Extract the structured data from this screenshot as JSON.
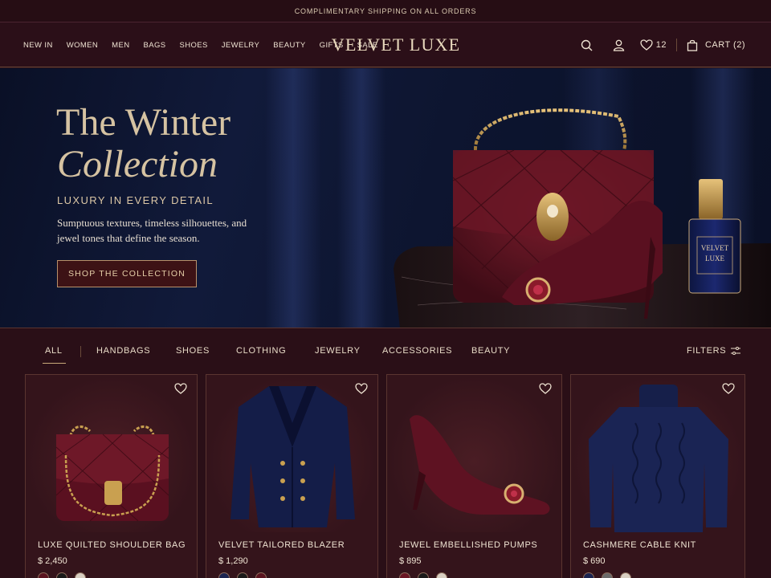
{
  "announcement": "COMPLIMENTARY SHIPPING ON ALL ORDERS",
  "header": {
    "brand": "VELVET LUXE",
    "nav": [
      "NEW IN",
      "WOMEN",
      "MEN",
      "BAGS",
      "SHOES",
      "JEWELRY",
      "BEAUTY",
      "GIFTS",
      "SALE"
    ],
    "wishlist_count": "12",
    "cart_label": "CART (2)"
  },
  "hero": {
    "title_line1": "The Winter",
    "title_line2": "Collection",
    "tagline": "LUXURY IN EVERY DETAIL",
    "description": "Sumptuous textures, timeless silhouettes, and jewel tones that define the season.",
    "cta": "SHOP THE COLLECTION",
    "perfume_label_line1": "VELVET",
    "perfume_label_line2": "LUXE"
  },
  "filters": {
    "tabs": [
      "ALL",
      "HANDBAGS",
      "SHOES",
      "CLOTHING",
      "JEWELRY",
      "ACCESSORIES",
      "BEAUTY"
    ],
    "active_tab": "ALL",
    "filters_label": "FILTERS"
  },
  "products": [
    {
      "name": "LUXE QUILTED SHOULDER BAG",
      "price": "$ 2,450",
      "swatches": [
        "#5a1420",
        "#1a1a1a",
        "#d8cfc2"
      ]
    },
    {
      "name": "VELVET TAILORED BLAZER",
      "price": "$ 1,290",
      "swatches": [
        "#1b2450",
        "#1a1a1a",
        "#5a1420"
      ]
    },
    {
      "name": "JEWEL EMBELLISHED PUMPS",
      "price": "$ 895",
      "swatches": [
        "#6a1624",
        "#1a1a1a",
        "#d8cfc2"
      ]
    },
    {
      "name": "CASHMERE CABLE KNIT",
      "price": "$ 690",
      "swatches": [
        "#1b2450",
        "#6a6a6a",
        "#d8cfc2"
      ]
    }
  ],
  "colors": {
    "background": "#2a0f17",
    "hero_background": "#0d1530",
    "accent_gold": "#c9a97a",
    "burgundy": "#5a1420"
  }
}
